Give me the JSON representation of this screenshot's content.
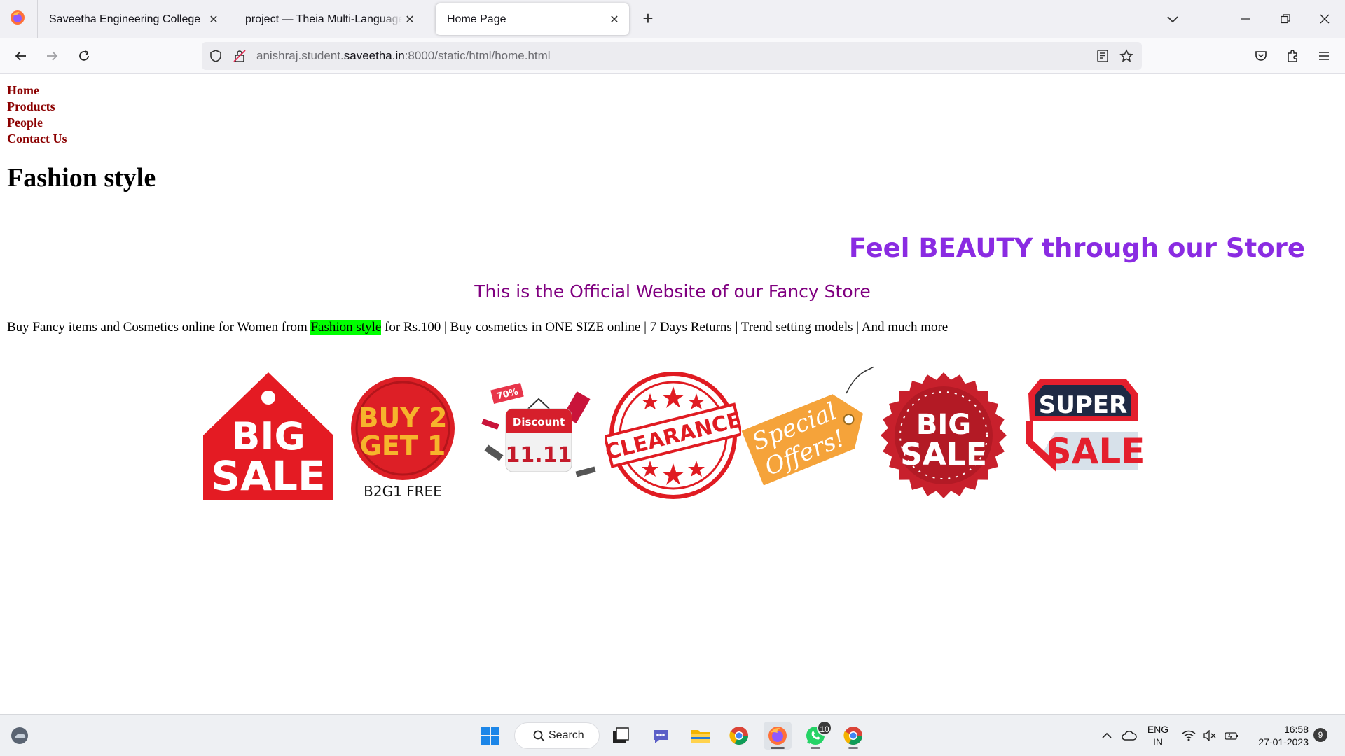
{
  "browser": {
    "tabs": [
      {
        "label": "Saveetha Engineering College",
        "active": false
      },
      {
        "label": "project — Theia Multi-Language Explorer",
        "active": false
      },
      {
        "label": "Home Page",
        "active": true
      }
    ],
    "url": {
      "prefix": "anishraj.student.",
      "domain": "saveetha.in",
      "suffix": ":8000/static/html/home.html"
    }
  },
  "page": {
    "menu": [
      {
        "label": "Home"
      },
      {
        "label": "Products"
      },
      {
        "label": "People"
      },
      {
        "label": "Contact Us"
      }
    ],
    "title": "Fashion style",
    "tagline": "Feel BEAUTY through our Store",
    "subtitle": "This is the Official Website of our Fancy Store",
    "description": {
      "before": "Buy Fancy items and Cosmetics online for Women from ",
      "highlight": "Fashion style",
      "after": " for Rs.100 | Buy cosmetics in ONE SIZE online | 7 Days Returns | Trend setting models | And much more"
    },
    "promos": {
      "big_sale_tag": {
        "line1": "BIG",
        "line2": "SALE"
      },
      "buy2get1": {
        "line1": "BUY 2",
        "line2": "GET 1",
        "caption": "B2G1 FREE"
      },
      "discount": {
        "label": "Discount",
        "date": "11.11",
        "pct": "70%"
      },
      "clearance": {
        "label": "CLEARANCE"
      },
      "special": {
        "line1": "Special",
        "line2": "Offers!"
      },
      "big_sale_seal": {
        "line1": "BIG",
        "line2": "SALE"
      },
      "super_sale": {
        "line1": "SUPER",
        "line2": "SALE"
      }
    },
    "colors": {
      "menu": "#8b0000",
      "tagline": "#8a2be2",
      "subtitle": "#800080",
      "highlight": "#00ff00"
    }
  },
  "taskbar": {
    "search_label": "Search",
    "whatsapp_badge": "10",
    "language": {
      "line1": "ENG",
      "line2": "IN"
    },
    "time": "16:58",
    "date": "27-01-2023",
    "notifications": "9"
  }
}
